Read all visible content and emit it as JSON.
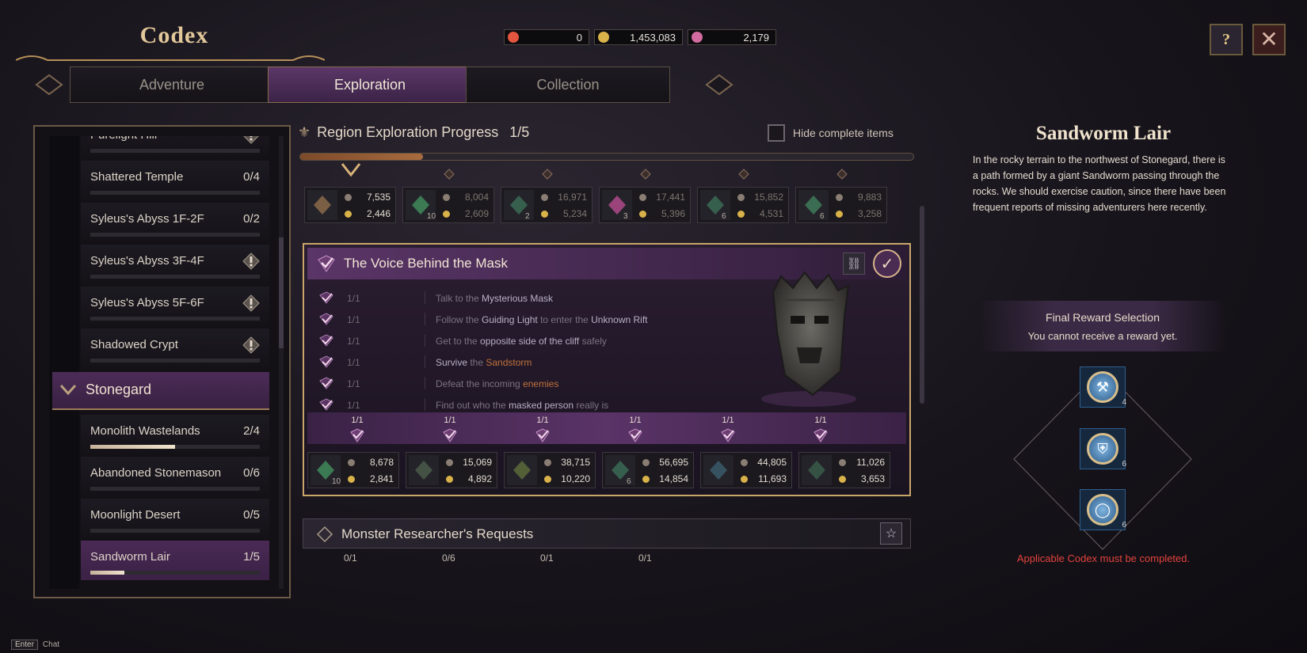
{
  "header": {
    "title": "Codex",
    "currencies": [
      {
        "icon": "tear-icon",
        "value": "0",
        "color": "#e2553f"
      },
      {
        "icon": "gold-coin-icon",
        "value": "1,453,083",
        "color": "#d9b24a"
      },
      {
        "icon": "pink-orb-icon",
        "value": "2,179",
        "color": "#d16b9f"
      }
    ]
  },
  "tabs": [
    {
      "label": "Adventure",
      "active": false
    },
    {
      "label": "Exploration",
      "active": true
    },
    {
      "label": "Collection",
      "active": false
    }
  ],
  "sidebar": {
    "items_top": [
      {
        "name": "Purelight Hill",
        "count": "",
        "locked": true,
        "progress": 0
      },
      {
        "name": "Shattered Temple",
        "count": "0/4",
        "locked": false,
        "progress": 0
      },
      {
        "name": "Syleus's Abyss 1F-2F",
        "count": "0/2",
        "locked": false,
        "progress": 0
      },
      {
        "name": "Syleus's Abyss 3F-4F",
        "count": "",
        "locked": true,
        "progress": 0
      },
      {
        "name": "Syleus's Abyss 5F-6F",
        "count": "",
        "locked": true,
        "progress": 0
      },
      {
        "name": "Shadowed Crypt",
        "count": "",
        "locked": true,
        "progress": 0
      }
    ],
    "group": {
      "name": "Stonegard"
    },
    "items_group": [
      {
        "name": "Monolith Wastelands",
        "count": "2/4",
        "progress": 0.5
      },
      {
        "name": "Abandoned Stonemason",
        "count": "0/6",
        "progress": 0
      },
      {
        "name": "Moonlight Desert",
        "count": "0/5",
        "progress": 0
      },
      {
        "name": "Sandworm Lair",
        "count": "1/5",
        "progress": 0.2,
        "selected": true
      }
    ]
  },
  "progress": {
    "label": "Region Exploration Progress",
    "value": "1/5",
    "fraction": 0.2,
    "hide_complete": "Hide complete items"
  },
  "region_rewards": [
    {
      "exp": "7,535",
      "gold": "2,446",
      "qty": "",
      "item_color": "#8a6a4a",
      "claimed": true
    },
    {
      "exp": "8,004",
      "gold": "2,609",
      "qty": "10",
      "item_color": "#3f8a5a",
      "claimed": false
    },
    {
      "exp": "16,971",
      "gold": "5,234",
      "qty": "2",
      "item_color": "#3a6a55",
      "claimed": false
    },
    {
      "exp": "17,441",
      "gold": "5,396",
      "qty": "3",
      "item_color": "#b04a8a",
      "claimed": false
    },
    {
      "exp": "15,852",
      "gold": "4,531",
      "qty": "6",
      "item_color": "#3a6a55",
      "claimed": false
    },
    {
      "exp": "9,883",
      "gold": "3,258",
      "qty": "6",
      "item_color": "#3f7a5a",
      "claimed": false
    }
  ],
  "quest": {
    "title": "The Voice Behind the Mask",
    "steps": [
      {
        "frac": "1/1",
        "parts": [
          "Talk to the ",
          "Mysterious Mask"
        ]
      },
      {
        "frac": "1/1",
        "parts": [
          "Follow the ",
          "Guiding Light",
          " to enter the ",
          "Unknown Rift"
        ]
      },
      {
        "frac": "1/1",
        "parts": [
          "Get to the ",
          "opposite side of the cliff",
          " safely"
        ]
      },
      {
        "frac": "1/1",
        "parts": [
          "Survive",
          " the ",
          "Sandstorm"
        ]
      },
      {
        "frac": "1/1",
        "parts": [
          "Defeat the incoming ",
          "enemies"
        ]
      },
      {
        "frac": "1/1",
        "parts": [
          "Find out who the ",
          "masked person",
          " really is"
        ]
      }
    ],
    "objective_fracs": [
      "1/1",
      "1/1",
      "1/1",
      "1/1",
      "1/1",
      "1/1"
    ],
    "rewards": [
      {
        "exp": "8,678",
        "gold": "2,841",
        "qty": "10",
        "item_color": "#3f8a5a"
      },
      {
        "exp": "15,069",
        "gold": "4,892",
        "qty": "",
        "item_color": "#4a5a4a"
      },
      {
        "exp": "38,715",
        "gold": "10,220",
        "qty": "",
        "item_color": "#5a6a3a"
      },
      {
        "exp": "56,695",
        "gold": "14,854",
        "qty": "6",
        "item_color": "#3a6a55"
      },
      {
        "exp": "44,805",
        "gold": "11,693",
        "qty": "",
        "item_color": "#3a5a6a"
      },
      {
        "exp": "11,026",
        "gold": "3,653",
        "qty": "",
        "item_color": "#3a5a4a"
      }
    ]
  },
  "monster": {
    "title": "Monster Researcher's Requests",
    "fracs": [
      "0/1",
      "0/6",
      "0/1",
      "0/1"
    ]
  },
  "detail": {
    "title": "Sandworm Lair",
    "description": "In the rocky terrain to the northwest of Stonegard, there is a path formed by a giant Sandworm passing through the rocks. We should exercise caution, since there have been frequent reports of missing adventurers here recently.",
    "final_title": "Final Reward Selection",
    "final_status": "You cannot receive a reward yet.",
    "rewards": [
      {
        "icon": "hammer-icon",
        "qty": "4",
        "glyph": "⚒"
      },
      {
        "icon": "armor-icon",
        "qty": "6",
        "glyph": "⛨"
      },
      {
        "icon": "ring-icon",
        "qty": "6",
        "glyph": "◯"
      }
    ],
    "warning": "Applicable Codex must be completed."
  },
  "footer": {
    "key": "Enter",
    "label": "Chat"
  },
  "colors": {
    "accent_purple": "#4c2c58",
    "gold_border": "#c9a56a",
    "warning_red": "#e3433d"
  }
}
